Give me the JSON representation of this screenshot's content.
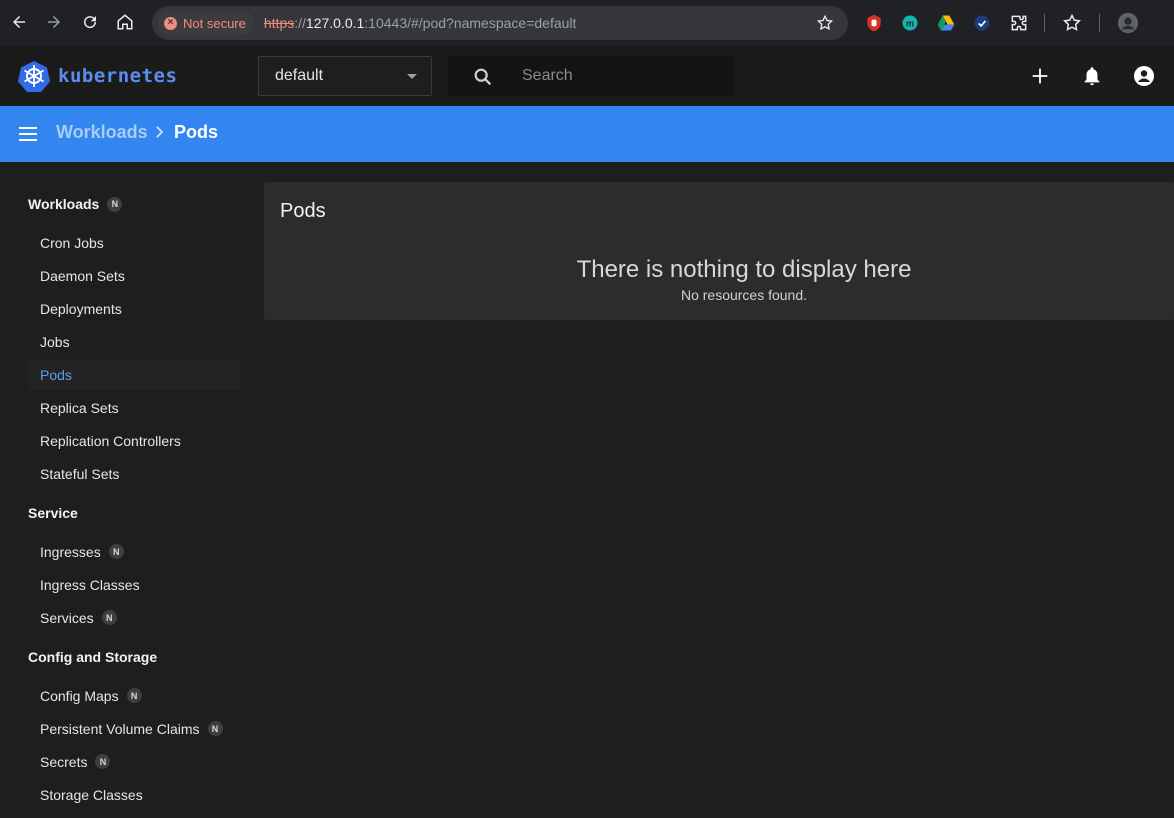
{
  "browser": {
    "security_label": "Not secure",
    "url_scheme": "https",
    "url_sep": "://",
    "url_host": "127.0.0.1",
    "url_rest": ":10443/#/pod?namespace=default"
  },
  "header": {
    "logo_text": "kubernetes",
    "namespace": "default",
    "search_placeholder": "Search"
  },
  "toolbar": {
    "breadcrumb_parent": "Workloads",
    "breadcrumb_current": "Pods"
  },
  "sidebar": {
    "sections": [
      {
        "title": "Workloads",
        "badge": "N",
        "items": [
          {
            "label": "Cron Jobs"
          },
          {
            "label": "Daemon Sets"
          },
          {
            "label": "Deployments"
          },
          {
            "label": "Jobs"
          },
          {
            "label": "Pods",
            "active": true
          },
          {
            "label": "Replica Sets"
          },
          {
            "label": "Replication Controllers"
          },
          {
            "label": "Stateful Sets"
          }
        ]
      },
      {
        "title": "Service",
        "items": [
          {
            "label": "Ingresses",
            "badge": "N"
          },
          {
            "label": "Ingress Classes"
          },
          {
            "label": "Services",
            "badge": "N"
          }
        ]
      },
      {
        "title": "Config and Storage",
        "items": [
          {
            "label": "Config Maps",
            "badge": "N"
          },
          {
            "label": "Persistent Volume Claims",
            "badge": "N"
          },
          {
            "label": "Secrets",
            "badge": "N"
          },
          {
            "label": "Storage Classes"
          }
        ]
      }
    ]
  },
  "main": {
    "card_title": "Pods",
    "empty_title": "There is nothing to display here",
    "empty_subtitle": "No resources found."
  },
  "colors": {
    "accent": "#3386f0",
    "logo": "#5b8def",
    "active_nav": "#5b9cf5"
  }
}
